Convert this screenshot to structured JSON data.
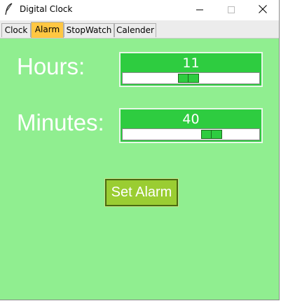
{
  "window": {
    "title": "Digital Clock"
  },
  "tabs": [
    {
      "label": "Clock"
    },
    {
      "label": "Alarm"
    },
    {
      "label": "StopWatch"
    },
    {
      "label": "Calender"
    }
  ],
  "active_tab": "Alarm",
  "alarm": {
    "hours_label": "Hours:",
    "minutes_label": "Minutes:",
    "hours_value": "11",
    "minutes_value": "40",
    "hours_range": [
      0,
      23
    ],
    "minutes_range": [
      0,
      59
    ],
    "set_button_label": "Set Alarm"
  },
  "colors": {
    "background": "#90ee90",
    "scale": "#2ecc40",
    "button": "#9acd32",
    "active_tab": "#ffc742"
  },
  "icons": [
    "feather-icon",
    "minimize-icon",
    "maximize-icon",
    "close-icon"
  ]
}
